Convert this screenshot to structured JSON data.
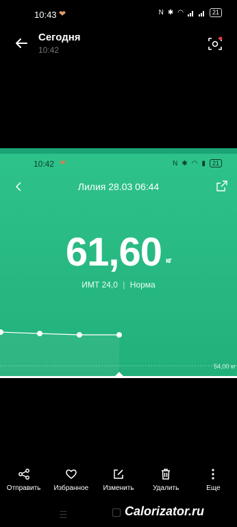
{
  "status_bar": {
    "time": "10:43",
    "battery": "21"
  },
  "header": {
    "title": "Сегодня",
    "subtitle": "10:42"
  },
  "screenshot": {
    "status_time": "10:42",
    "battery": "21",
    "title": "Лилия 28.03 06:44",
    "weight_value": "61,60",
    "weight_unit": "кг",
    "bmi_text": "ИМТ 24,0",
    "bmi_status": "Норма",
    "baseline_label": "54,00 кг"
  },
  "toolbar": [
    {
      "label": "Отправить",
      "icon": "share-icon"
    },
    {
      "label": "Избранное",
      "icon": "heart-icon"
    },
    {
      "label": "Изменить",
      "icon": "edit-icon"
    },
    {
      "label": "Удалить",
      "icon": "trash-icon"
    },
    {
      "label": "Еще",
      "icon": "more-icon"
    }
  ],
  "watermark": "Calorizator.ru"
}
